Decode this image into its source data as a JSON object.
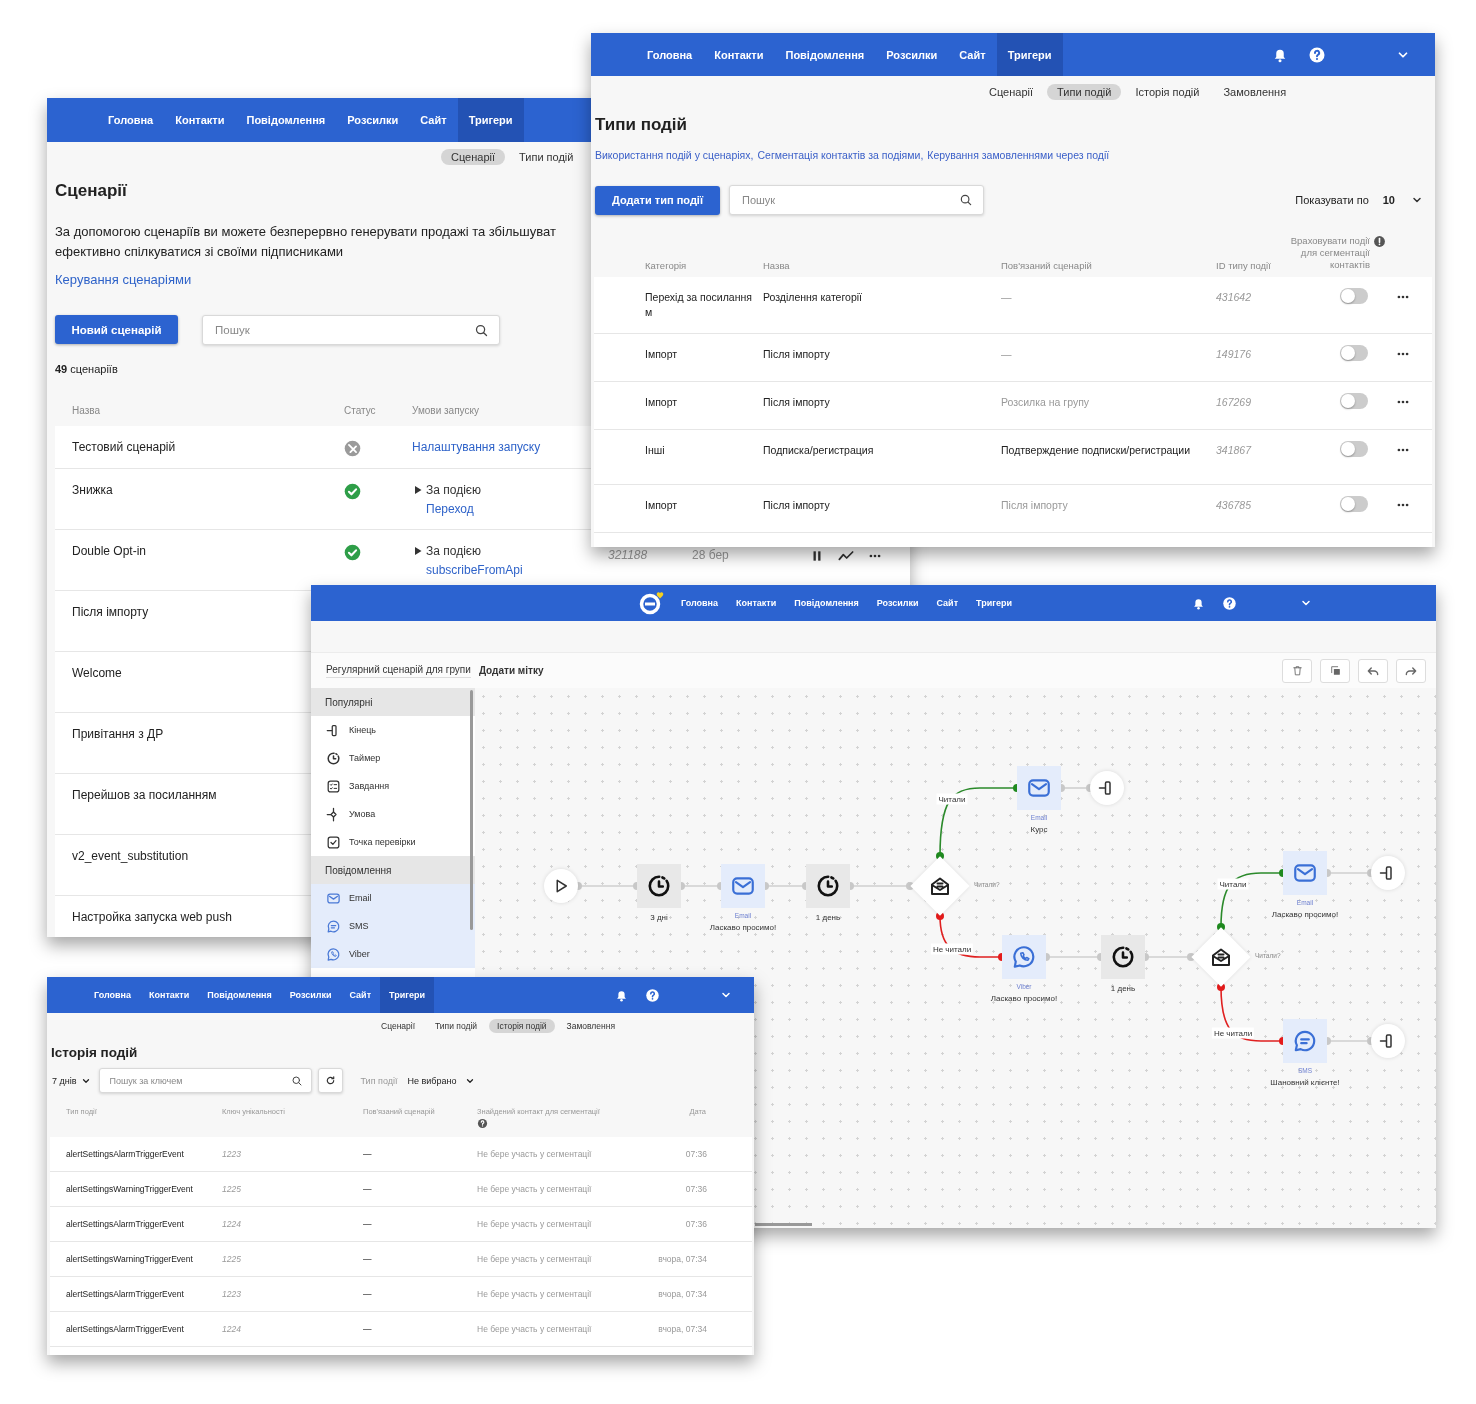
{
  "scenarios": {
    "nav": [
      {
        "label": "Головна",
        "selected": false
      },
      {
        "label": "Контакти",
        "selected": false
      },
      {
        "label": "Повідомлення",
        "selected": false
      },
      {
        "label": "Розсилки",
        "selected": false
      },
      {
        "label": "Сайт",
        "selected": false
      },
      {
        "label": "Тригери",
        "selected": true
      }
    ],
    "subtabs": [
      {
        "label": "Сценарії",
        "selected": true
      },
      {
        "label": "Типи подій",
        "selected": false
      }
    ],
    "title": "Сценарії",
    "description_lines": [
      "За допомогою сценаріїв ви можете безперервно генерувати продажі та збільшуват",
      "ефективно спілкуватися зі своїми підписниками"
    ],
    "manage_link": "Керування сценаріями",
    "new_button": "Новий сценарій",
    "search": {
      "placeholder": "Пошук"
    },
    "count": "**49** сценаріїв",
    "columns": [
      "Назва",
      "Статус",
      "Умови запуску"
    ],
    "rows": [
      {
        "name": "Тестовий сценарій",
        "active": false,
        "condition": {
          "kind": "setup",
          "link": "Налаштування запуску"
        }
      },
      {
        "name": "Знижка",
        "active": true,
        "condition": {
          "kind": "event",
          "label": "За подією",
          "event": "Переход"
        }
      },
      {
        "name": "Double Opt-in",
        "active": true,
        "condition": {
          "kind": "event",
          "label": "За подією",
          "event": "subscribeFromApi"
        },
        "id": "321188",
        "date": "28 бер"
      },
      {
        "name": "Після імпорту"
      },
      {
        "name": "Welcome"
      },
      {
        "name": "Привітання з ДР"
      },
      {
        "name": "Перейшов за посиланням"
      },
      {
        "name": "v2_event_substitution"
      },
      {
        "name": "Настройка запуска web push"
      }
    ]
  },
  "event_types": {
    "nav": [
      {
        "label": "Головна",
        "selected": false
      },
      {
        "label": "Контакти",
        "selected": false
      },
      {
        "label": "Повідомлення",
        "selected": false
      },
      {
        "label": "Розсилки",
        "selected": false
      },
      {
        "label": "Сайт",
        "selected": false
      },
      {
        "label": "Тригери",
        "selected": true
      }
    ],
    "subtabs": [
      {
        "label": "Сценарії",
        "selected": false
      },
      {
        "label": "Типи подій",
        "selected": true
      },
      {
        "label": "Історія подій",
        "selected": false
      },
      {
        "label": "Замовлення",
        "selected": false
      }
    ],
    "title": "Типи подій",
    "links": [
      "Використання подій у сценаріях,",
      "Сегментація контактів за подіями,",
      "Керування замовленнями через події"
    ],
    "add_button": "Додати тип події",
    "search": {
      "placeholder": "Пошук"
    },
    "page_size": {
      "label": "Показувати по",
      "value": "10"
    },
    "columns": [
      "Категорія",
      "Назва",
      "Пов'язаний сценарій",
      "ID типу події",
      "Враховувати події для сегментації контактів"
    ],
    "rows": [
      {
        "category": "Перехід за посиланням",
        "name": "Розділення категорії",
        "scenario": "—",
        "muted": true,
        "id": "431642",
        "on": false
      },
      {
        "category": "Імпорт",
        "name": "Після імпорту",
        "scenario": "—",
        "muted": true,
        "id": "149176",
        "on": false
      },
      {
        "category": "Імпорт",
        "name": "Після імпорту",
        "scenario": "Розсилка на групу",
        "muted": true,
        "id": "167269",
        "on": false
      },
      {
        "category": "Інші",
        "name": "Подписка/регистрация",
        "scenario": "Подтверждение подписки/регистрации",
        "muted": false,
        "id": "341867",
        "on": false
      },
      {
        "category": "Імпорт",
        "name": "Після імпорту",
        "scenario": "Після імпорту",
        "muted": true,
        "id": "436785",
        "on": false
      }
    ]
  },
  "editor": {
    "nav": [
      {
        "label": "Головна",
        "selected": false
      },
      {
        "label": "Контакти",
        "selected": false
      },
      {
        "label": "Повідомлення",
        "selected": false
      },
      {
        "label": "Розсилки",
        "selected": false
      },
      {
        "label": "Сайт",
        "selected": false
      },
      {
        "label": "Тригери",
        "selected": false
      }
    ],
    "scenario_name": "Регулярний сценарій для групи",
    "add_tag": "Додати мітку",
    "palette": [
      {
        "title": "Популярні",
        "items": [
          {
            "kind": "end",
            "label": "Кінець"
          },
          {
            "kind": "timer",
            "label": "Таймер"
          },
          {
            "kind": "task",
            "label": "Завдання"
          },
          {
            "kind": "condition",
            "label": "Умова"
          },
          {
            "kind": "checkpoint",
            "label": "Точка перевірки"
          }
        ]
      },
      {
        "title": "Повідомлення",
        "items": [
          {
            "kind": "email",
            "label": "Email"
          },
          {
            "kind": "sms",
            "label": "SMS"
          },
          {
            "kind": "viber",
            "label": "Viber"
          }
        ]
      }
    ],
    "flow": [
      {
        "kind": "start"
      },
      {
        "kind": "timer",
        "label": "3 дні"
      },
      {
        "kind": "email",
        "channel": "Email",
        "label": "Ласкаво просимо!"
      },
      {
        "kind": "timer",
        "label": "1 день"
      },
      {
        "kind": "condition",
        "question": "Читали?",
        "yes": "Читали",
        "no": "Не читали"
      },
      {
        "kind": "email",
        "channel": "Email",
        "label": "Курс"
      },
      {
        "kind": "end"
      },
      {
        "kind": "viber",
        "channel": "Viber",
        "label": "Ласкаво просимо!"
      },
      {
        "kind": "timer",
        "label": "1 день"
      },
      {
        "kind": "condition",
        "question": "Читали?",
        "yes": "Читали",
        "no": "Не читали"
      },
      {
        "kind": "email",
        "channel": "Email",
        "label": "Ласкаво просимо!"
      },
      {
        "kind": "end"
      },
      {
        "kind": "sms",
        "channel": "SMS",
        "label": "Шановний клієнте!"
      },
      {
        "kind": "end"
      }
    ]
  },
  "history": {
    "nav": [
      {
        "label": "Головна",
        "selected": false
      },
      {
        "label": "Контакти",
        "selected": false
      },
      {
        "label": "Повідомлення",
        "selected": false
      },
      {
        "label": "Розсилки",
        "selected": false
      },
      {
        "label": "Сайт",
        "selected": false
      },
      {
        "label": "Тригери",
        "selected": true
      }
    ],
    "subtabs": [
      {
        "label": "Сценарії",
        "selected": false
      },
      {
        "label": "Типи подій",
        "selected": false
      },
      {
        "label": "Історія подій",
        "selected": true
      },
      {
        "label": "Замовлення",
        "selected": false
      }
    ],
    "title": "Історія подій",
    "period": "7 днів",
    "search": {
      "placeholder": "Пошук за ключем"
    },
    "type_filter": {
      "label": "Тип події",
      "value": "Не вибрано"
    },
    "columns": [
      "Тип події",
      "Ключ унікальності",
      "Пов'язаний сценарій",
      "Знайдений контакт для сегментації",
      "Дата"
    ],
    "rows": [
      {
        "type": "alertSettingsAlarmTriggerEvent",
        "key": "1223",
        "scenario": "—",
        "contact": "Не бере участь у сегментації",
        "date": "07:36"
      },
      {
        "type": "alertSettingsWarningTriggerEvent",
        "key": "1225",
        "scenario": "—",
        "contact": "Не бере участь у сегментації",
        "date": "07:36"
      },
      {
        "type": "alertSettingsAlarmTriggerEvent",
        "key": "1224",
        "scenario": "—",
        "contact": "Не бере участь у сегментації",
        "date": "07:36"
      },
      {
        "type": "alertSettingsWarningTriggerEvent",
        "key": "1225",
        "scenario": "—",
        "contact": "Не бере участь у сегментації",
        "date": "вчора, 07:34"
      },
      {
        "type": "alertSettingsAlarmTriggerEvent",
        "key": "1223",
        "scenario": "—",
        "contact": "Не бере участь у сегментації",
        "date": "вчора, 07:34"
      },
      {
        "type": "alertSettingsAlarmTriggerEvent",
        "key": "1224",
        "scenario": "—",
        "contact": "Не бере участь у сегментації",
        "date": "вчора, 07:34"
      }
    ]
  }
}
